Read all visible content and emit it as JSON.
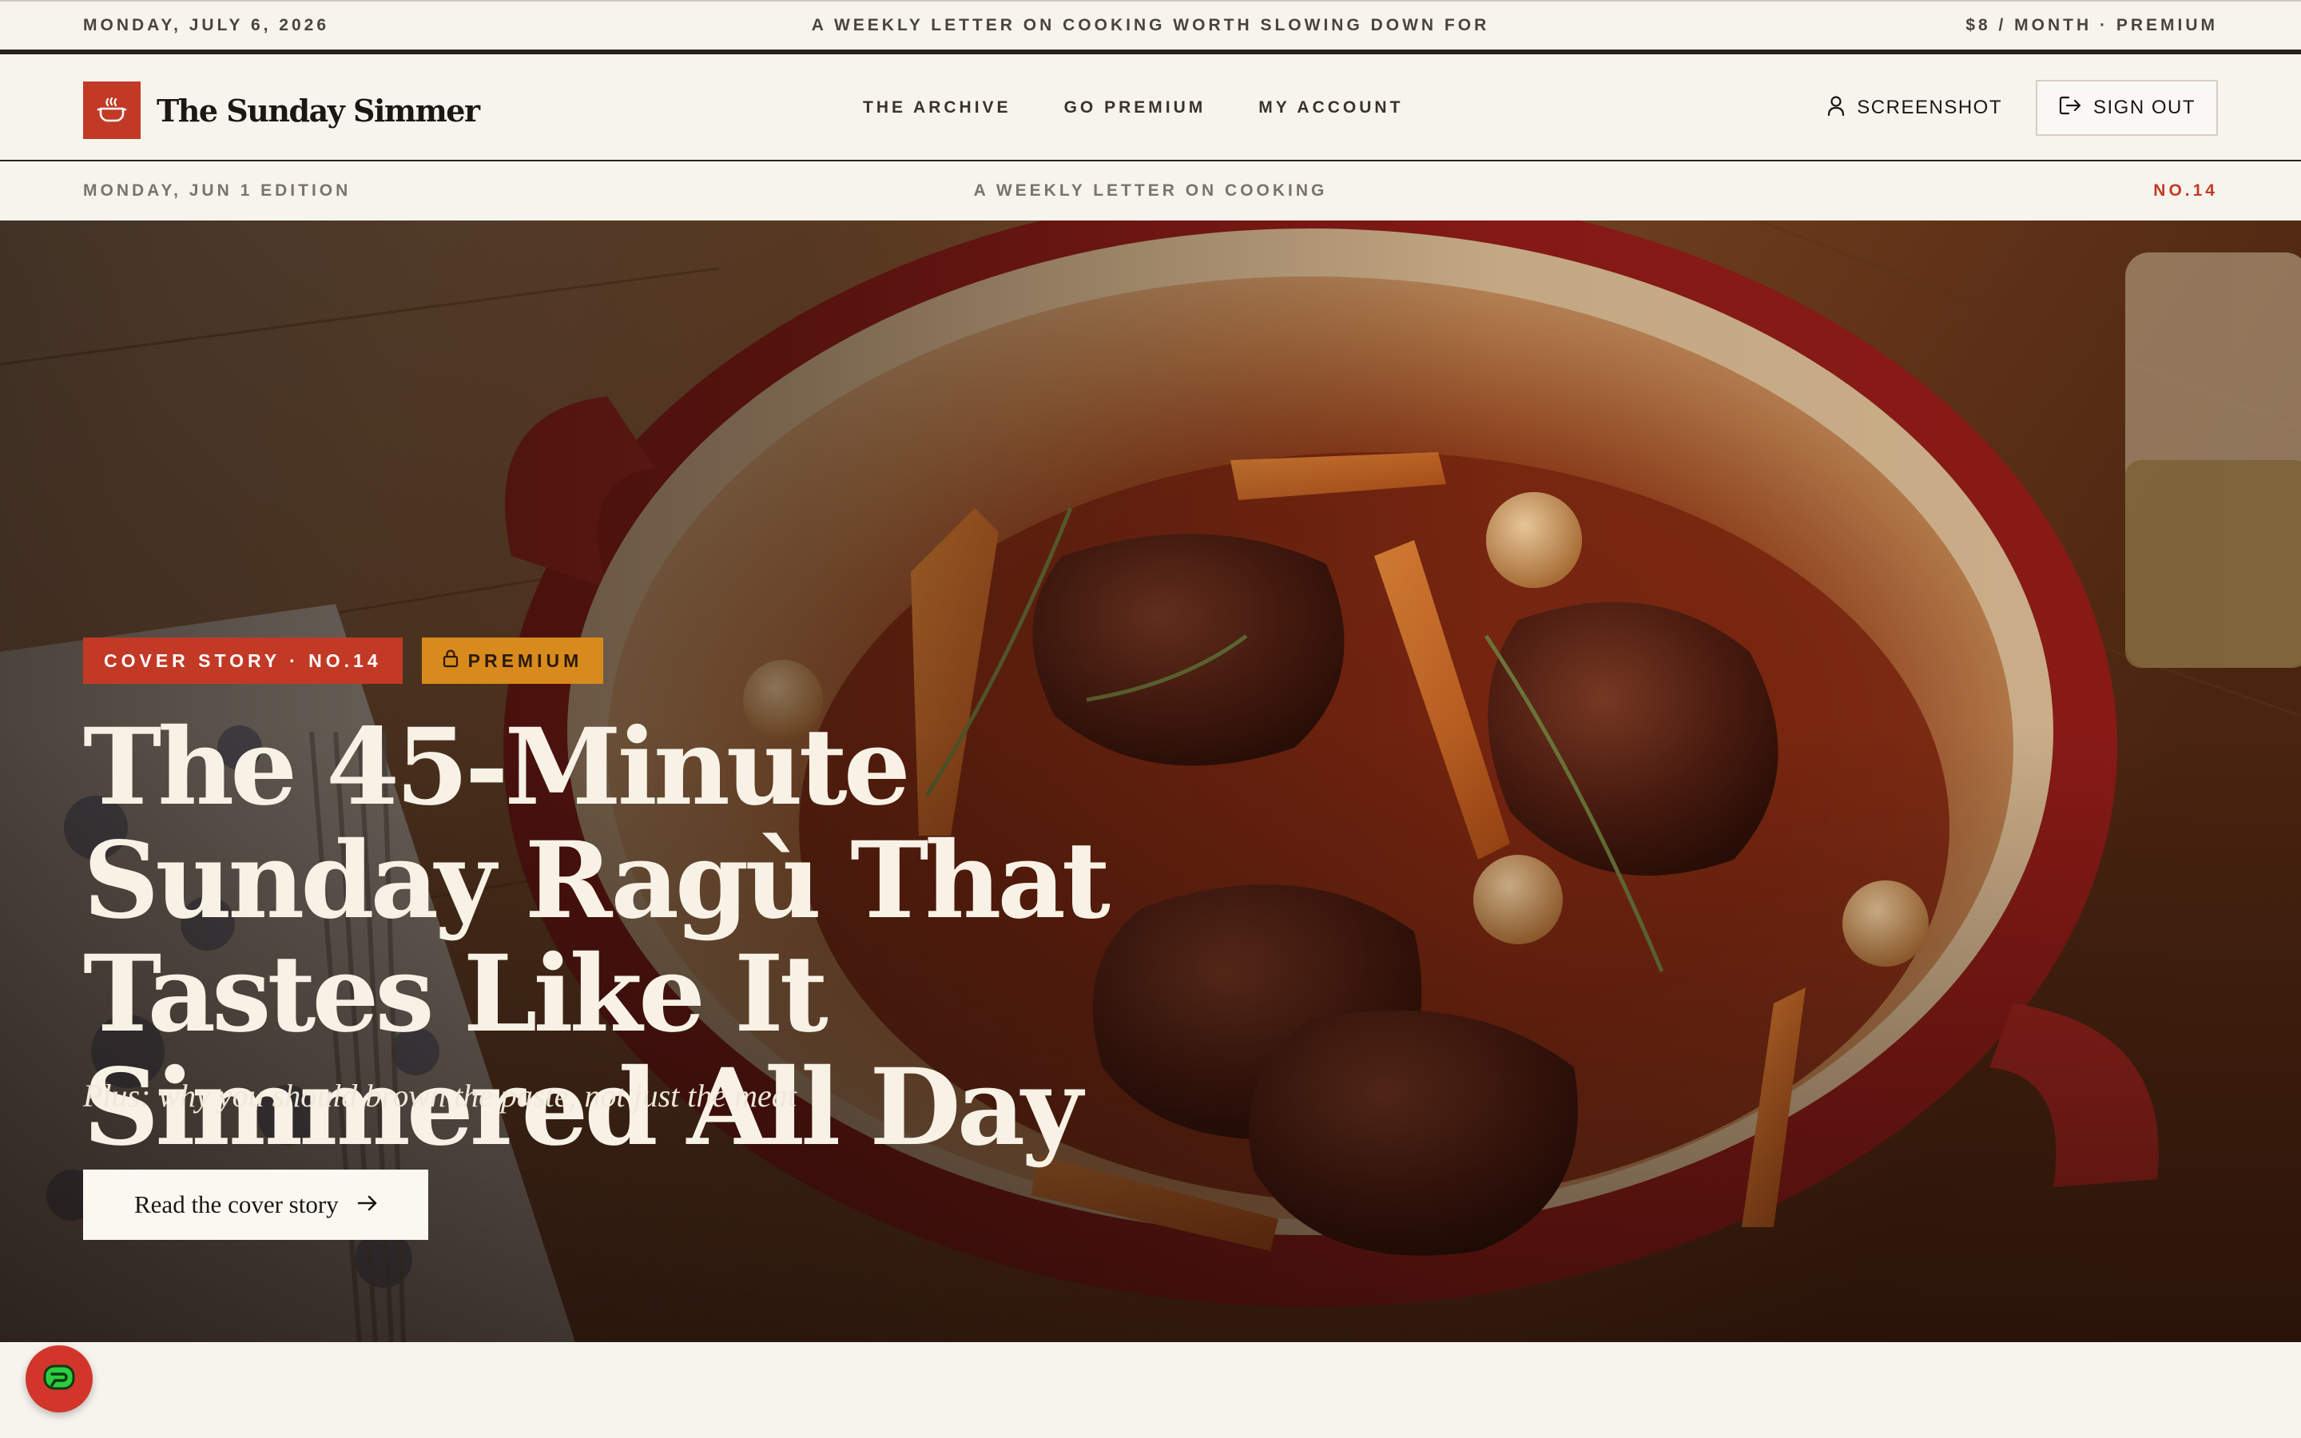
{
  "topbar": {
    "date": "MONDAY, JULY 6, 2026",
    "tagline": "A WEEKLY LETTER ON COOKING WORTH SLOWING DOWN FOR",
    "price": "$8 / MONTH · PREMIUM"
  },
  "header": {
    "brand": "The Sunday Simmer",
    "nav": [
      {
        "label": "THE ARCHIVE"
      },
      {
        "label": "GO PREMIUM"
      },
      {
        "label": "MY ACCOUNT"
      }
    ],
    "user_label": "SCREENSHOT",
    "signout_label": "SIGN OUT"
  },
  "edition": {
    "date": "MONDAY, JUN 1 EDITION",
    "tagline": "A WEEKLY LETTER ON COOKING",
    "issue": "NO.14"
  },
  "hero": {
    "badge_cover": "COVER STORY · NO.14",
    "badge_premium": "PREMIUM",
    "headline": "The 45-Minute Sunday Ragù That Tastes Like It Simmered All Day",
    "dek": "Plus: why you should brown the paste, not just the meat",
    "cta_label": "Read the cover story"
  },
  "icons": {
    "logo": "pot-icon",
    "user": "user-icon",
    "signout": "sign-out-icon",
    "premium": "lock-icon",
    "cta": "arrow-right-icon",
    "widget": "chat-widget-icon"
  },
  "colors": {
    "accent": "#c23a26",
    "premium": "#d98a1c",
    "background": "#f7f4ee",
    "ink": "#1c1714"
  }
}
